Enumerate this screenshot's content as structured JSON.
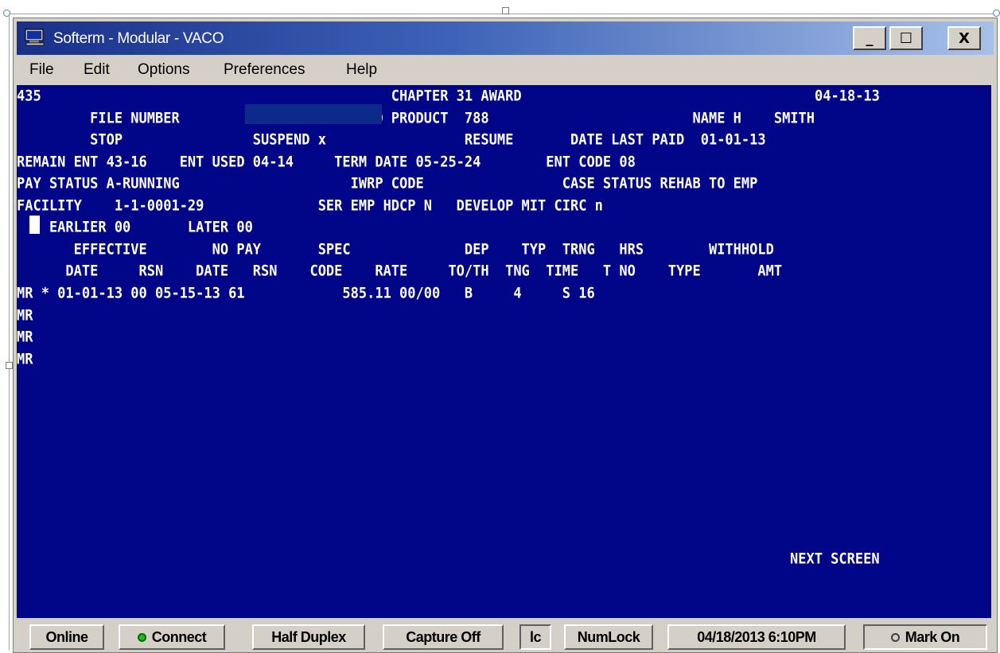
{
  "window": {
    "title": "Softerm - Modular - VACO",
    "controls": {
      "minimize": "_",
      "maximize": "☐",
      "close": "X"
    }
  },
  "menu": [
    "File",
    "Edit",
    "Options",
    "Preferences",
    "Help"
  ],
  "terminal": {
    "lines": [
      "435                                           CHAPTER 31 AWARD                                    04-18-13",
      "         FILE NUMBER               -00    END PRODUCT  788                         NAME H    SMITH",
      "         STOP                SUSPEND x                 RESUME       DATE LAST PAID  01-01-13",
      "REMAIN ENT 43-16    ENT USED 04-14     TERM DATE 05-25-24        ENT CODE 08",
      "PAY STATUS A-RUNNING                     IWRP CODE                 CASE STATUS REHAB TO EMP",
      "FACILITY    1-1-0001-29              SER EMP HDCP N   DEVELOP MIT CIRC n",
      "    EARLIER 00       LATER 00",
      "       EFFECTIVE        NO PAY       SPEC              DEP    TYP  TRNG   HRS        WITHHOLD",
      "      DATE     RSN    DATE   RSN    CODE    RATE     TO/TH  TNG  TIME   T NO    TYPE       AMT",
      "MR * 01-01-13 00 05-15-13 61            585.11 00/00   B     4     S 16",
      "MR",
      "MR",
      "MR"
    ],
    "footer": "NEXT SCREEN"
  },
  "status_bar": {
    "online": "Online",
    "connect": "Connect",
    "duplex": "Half Duplex",
    "capture": "Capture Off",
    "lc": "lc",
    "numlock": "NumLock",
    "datetime": "04/18/2013 6:10PM",
    "mark": "Mark On"
  },
  "colors": {
    "terminal_bg": "#010688",
    "terminal_text": "#ffffff",
    "connect_indicator": "#18c018"
  }
}
